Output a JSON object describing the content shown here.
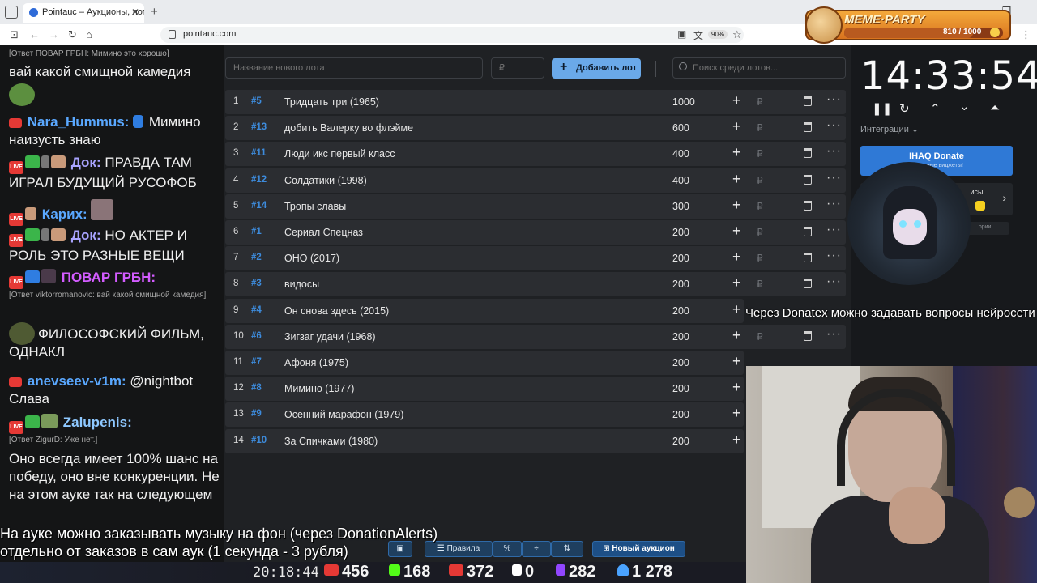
{
  "browser": {
    "tab_title": "Pointauc – Аукционы, лотереи",
    "url": "pointauc.com",
    "zoom": "90%"
  },
  "chat": {
    "top_reply": "[Ответ ПОВАР ГРБН: Мимино это хорошо]",
    "messages": [
      {
        "text": "вай какой смищной камедия"
      },
      {
        "nick": "Nara_Hummus:",
        "nick_color": "#5aa8ff",
        "text": "Мимино наизусть знаю"
      },
      {
        "nick": "Док:",
        "nick_color": "#a9a4ff",
        "text": "ПРАВДА ТАМ ИГРАЛ БУДУЩИЙ РУСОФОБ"
      },
      {
        "nick": "Карих:",
        "nick_color": "#5aa8ff",
        "text": ""
      },
      {
        "nick": "Док:",
        "nick_color": "#a9a4ff",
        "text": "НО АКТЕР И РОЛЬ ЭТО РАЗНЫЕ ВЕЩИ"
      },
      {
        "nick": "ПОВАР ГРБН:",
        "nick_color": "#d35cff",
        "text": ""
      },
      {
        "reply": "[Ответ viktorromanovic: вай какой смищной камедия]"
      },
      {
        "text": "ФИЛОСОФСКИЙ ФИЛЬМ, ОДНАКЛ"
      },
      {
        "nick": "anevseev-v1m:",
        "nick_color": "#5aa8ff",
        "text": "@nightbot Слава"
      },
      {
        "nick": "Zalupenis:",
        "nick_color": "#8ec8ff",
        "text": ""
      },
      {
        "reply": "[Ответ ZigurD: Уже нет.]"
      },
      {
        "text": "Оно всегда имеет 100% шанс на победу, оно вне конкуренции. Не на этом ауке так на следующем"
      }
    ]
  },
  "auction": {
    "new_lot_placeholder": "Название нового лота",
    "amount_placeholder": "₽",
    "add_button": "Добавить лот",
    "search_placeholder": "Поиск среди лотов...",
    "plus": "+",
    "rub": "₽",
    "more": "···",
    "lots": [
      {
        "pos": "1",
        "id": "#5",
        "name": "Тридцать три (1965)",
        "amount": "1000"
      },
      {
        "pos": "2",
        "id": "#13",
        "name": "добить Валерку во флэйме",
        "amount": "600"
      },
      {
        "pos": "3",
        "id": "#11",
        "name": "Люди икс первый класс",
        "amount": "400"
      },
      {
        "pos": "4",
        "id": "#12",
        "name": "Солдатики (1998)",
        "amount": "400"
      },
      {
        "pos": "5",
        "id": "#14",
        "name": "Тропы славы",
        "amount": "300"
      },
      {
        "pos": "6",
        "id": "#1",
        "name": "Сериал Спецназ",
        "amount": "200"
      },
      {
        "pos": "7",
        "id": "#2",
        "name": "ОНО (2017)",
        "amount": "200"
      },
      {
        "pos": "8",
        "id": "#3",
        "name": "видосы",
        "amount": "200"
      },
      {
        "pos": "9",
        "id": "#4",
        "name": "Он снова здесь (2015)",
        "amount": "200"
      },
      {
        "pos": "10",
        "id": "#6",
        "name": "Зигзаг удачи (1968)",
        "amount": "200"
      },
      {
        "pos": "11",
        "id": "#7",
        "name": "Афоня (1975)",
        "amount": "200"
      },
      {
        "pos": "12",
        "id": "#8",
        "name": "Мимино (1977)",
        "amount": "200"
      },
      {
        "pos": "13",
        "id": "#9",
        "name": "Осенний марафон (1979)",
        "amount": "200"
      },
      {
        "pos": "14",
        "id": "#10",
        "name": "За Спичками (1980)",
        "amount": "200"
      }
    ],
    "toolbar": {
      "rules": "Правила",
      "percent": "%",
      "new_auction": "Новый аукцион"
    }
  },
  "timer": {
    "time": "14:33:54",
    "integrations_label": "Интеграции",
    "ihaq_title": "IHAQ Donate",
    "ihaq_sub": "...кальные виджеты!",
    "card_label": "...исы",
    "card3_label": "...ории"
  },
  "overlays": {
    "donatex_note": "Через Donatex можно задавать вопросы нейросети",
    "music_note_line1": "На ауке можно заказывать музыку на фон (через DonationAlerts)",
    "music_note_line2": "отдельно от заказов в сам аук (1 секунда - 3 рубля)"
  },
  "stream_stats": {
    "clock": "20:18:44",
    "youtube": "456",
    "kick": "168",
    "vk_live": "372",
    "rumble": "0",
    "twitch": "282",
    "total": "1 278"
  },
  "meme_party": {
    "title": "MEME·PARTY",
    "progress_text": "810 / 1000",
    "progress_value": 0.81
  },
  "colors": {
    "accent": "#6aa9e9",
    "id_blue": "#3d8bdc",
    "row_bg": "#2b2d31",
    "page_bg": "#1f2124"
  }
}
